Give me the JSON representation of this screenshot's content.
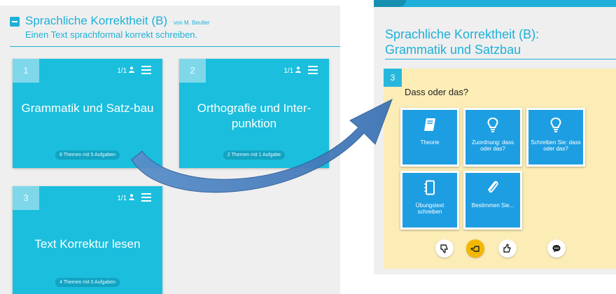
{
  "course": {
    "title": "Sprachliche Korrektheit (B)",
    "author": "von M. Beutler",
    "subtitle": "Einen Text sprachformal korrekt schreiben."
  },
  "tiles": [
    {
      "number": "1",
      "users": "1/1",
      "title": "Grammatik und Satz-bau",
      "badge": "8 Themen mit 5 Aufgaben"
    },
    {
      "number": "2",
      "users": "1/1",
      "title": "Orthografie und Inter-punktion",
      "badge": "2 Themen mit 1 Aufgabe"
    },
    {
      "number": "3",
      "users": "1/1",
      "title": "Text Korrektur lesen",
      "badge": "4 Themen mit 0 Aufgaben"
    }
  ],
  "chapter": {
    "title_line1": "Sprachliche Korrektheit (B):",
    "title_line2": "Grammatik und Satzbau"
  },
  "topic": {
    "number": "3",
    "question": "Dass oder das?",
    "tasks": [
      {
        "label": "Theorie",
        "icon": "book-icon"
      },
      {
        "label": "Zuordnung: dass oder das?",
        "icon": "lightbulb-icon"
      },
      {
        "label": "Schreiben Sie: dass oder das?",
        "icon": "lightbulb-icon"
      },
      {
        "label": "Übungstext schreiben",
        "icon": "notebook-icon"
      },
      {
        "label": "Bestimmen Sie...",
        "icon": "paperclip-icon"
      }
    ]
  },
  "feedback": {
    "buttons": [
      "thumbs-down-icon",
      "thumbs-sideways-icon",
      "thumbs-up-icon",
      "comment-icon"
    ],
    "active": "thumbs-sideways-icon"
  },
  "colors": {
    "primary": "#1eb0d8",
    "tile": "#1bbedd",
    "task": "#1e9ee2",
    "topic_card_bg": "#fcecb6",
    "active_feedback": "#f2b800",
    "arrow": "#3d74b5"
  }
}
